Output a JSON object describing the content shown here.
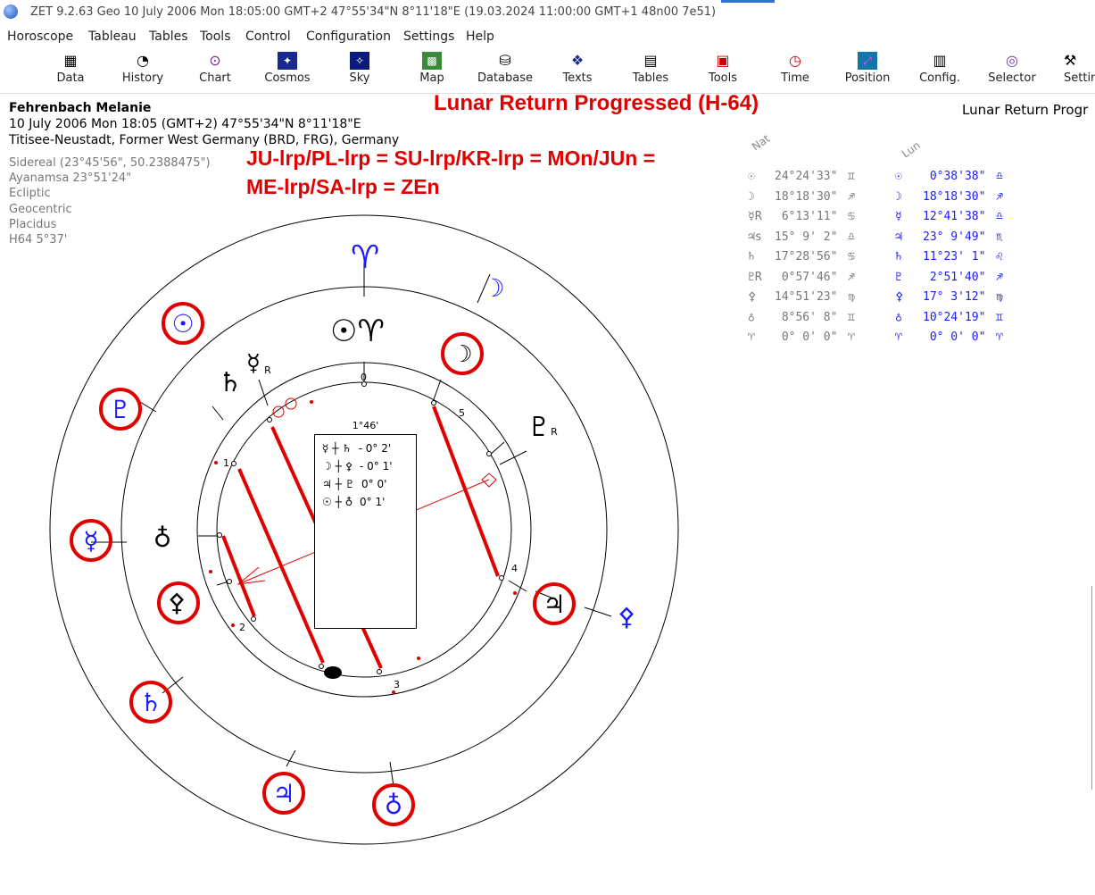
{
  "window": {
    "title": "ZET 9.2.63 Geo    10 July 2006  Mon   18:05:00 GMT+2 47°55'34\"N  8°11'18\"E  (19.03.2024  11:00:00 GMT+1 48n00 7e51)"
  },
  "menu": [
    "Horoscope",
    "Tableau",
    "Tables",
    "Tools",
    "Control",
    "Configuration",
    "Settings",
    "Help"
  ],
  "toolbar": [
    {
      "label": "Data",
      "icon": "data-icon"
    },
    {
      "label": "History",
      "icon": "history-icon"
    },
    {
      "label": "Chart",
      "icon": "chart-icon"
    },
    {
      "label": "Cosmos",
      "icon": "cosmos-icon"
    },
    {
      "label": "Sky",
      "icon": "sky-icon"
    },
    {
      "label": "Map",
      "icon": "map-icon"
    },
    {
      "label": "Database",
      "icon": "database-icon"
    },
    {
      "label": "Texts",
      "icon": "texts-icon"
    },
    {
      "label": "Tables",
      "icon": "tables-icon"
    },
    {
      "label": "Tools",
      "icon": "tools-icon"
    },
    {
      "label": "Time",
      "icon": "time-icon"
    },
    {
      "label": "Position",
      "icon": "position-icon"
    },
    {
      "label": "Config.",
      "icon": "config-icon"
    },
    {
      "label": "Selector",
      "icon": "selector-icon"
    },
    {
      "label": "Settin",
      "icon": "settings-icon"
    }
  ],
  "person": {
    "name": "Fehrenbach Melanie",
    "datetime": "10 July 2006  Mon  18:05 (GMT+2) 47°55'34\"N  8°11'18\"E",
    "place": "Titisee-Neustadt, Former West Germany (BRD, FRG), Germany"
  },
  "settings": [
    "Sidereal (23°45'56\", 50.2388475\")",
    "Ayanamsa 23°51'24\"",
    "Ecliptic",
    "Geocentric",
    "Placidus",
    "H64   5°37'"
  ],
  "chart_title": "Lunar Return Progressed (H-64)",
  "chart_title_right": "Lunar Return Progr",
  "formula": {
    "line1": "JU-lrp/PL-lrp = SU-lrp/KR-lrp = MOn/JUn =",
    "line2": "ME-lrp/SA-lrp = ZEn"
  },
  "table_headers": {
    "left": "Nat",
    "right": "Lun"
  },
  "positions": [
    {
      "gl": "☉",
      "nat": "24°24'33\"",
      "nsign": "♊",
      "lg": "☉",
      "lun": " 0°38'38\"",
      "lsign": "♎"
    },
    {
      "gl": "☽",
      "nat": "18°18'30\"",
      "nsign": "♐",
      "lg": "☽",
      "lun": "18°18'30\"",
      "lsign": "♐"
    },
    {
      "gl": "☿R",
      "nat": " 6°13'11\"",
      "nsign": "♋",
      "lg": "☿",
      "lun": "12°41'38\"",
      "lsign": "♎"
    },
    {
      "gl": "♃s",
      "nat": "15° 9' 2\"",
      "nsign": "♎",
      "lg": "♃",
      "lun": "23° 9'49\"",
      "lsign": "♏"
    },
    {
      "gl": "♄",
      "nat": "17°28'56\"",
      "nsign": "♋",
      "lg": "♄",
      "lun": "11°23' 1\"",
      "lsign": "♌"
    },
    {
      "gl": "♇R",
      "nat": " 0°57'46\"",
      "nsign": "♐",
      "lg": "♇",
      "lun": " 2°51'40\"",
      "lsign": "♐"
    },
    {
      "gl": "⚴",
      "nat": "14°51'23\"",
      "nsign": "♍",
      "lg": "⚴",
      "lun": "17° 3'12\"",
      "lsign": "♍"
    },
    {
      "gl": "♁",
      "nat": " 8°56' 8\"",
      "nsign": "♊",
      "lg": "♁",
      "lun": "10°24'19\"",
      "lsign": "♊"
    },
    {
      "gl": "♈",
      "nat": " 0° 0' 0\"",
      "nsign": "♈",
      "lg": "♈",
      "lun": " 0° 0' 0\"",
      "lsign": "♈"
    }
  ],
  "aspect_box": {
    "title": "1°46'",
    "rows": [
      {
        "a": "☿",
        "b": "♄",
        "val": "- 0° 2'"
      },
      {
        "a": "☽",
        "b": "⚴",
        "val": "- 0° 1'"
      },
      {
        "a": "♃",
        "b": "♇",
        "val": "0° 0'"
      },
      {
        "a": "☉",
        "b": "♁",
        "val": "0° 1'"
      }
    ]
  },
  "wheel": {
    "top_aries": "♈",
    "sun_aries": "☉♈",
    "house_numbers": [
      "0",
      "1",
      "2",
      "3",
      "4",
      "5"
    ],
    "outer_glyphs": [
      {
        "name": "outer-moon-glyph",
        "glyph": "☽"
      },
      {
        "name": "outer-sun-glyph",
        "glyph": "☉"
      },
      {
        "name": "outer-pluto-glyph",
        "glyph": "♇"
      },
      {
        "name": "outer-mercury-glyph",
        "glyph": "☿"
      },
      {
        "name": "outer-saturn-glyph",
        "glyph": "♄"
      },
      {
        "name": "outer-jupiter-glyph",
        "glyph": "♃"
      },
      {
        "name": "outer-earth-glyph",
        "glyph": "♁"
      },
      {
        "name": "outer-kronos-glyph",
        "glyph": "⚴"
      }
    ],
    "inner_glyphs": [
      {
        "name": "inner-saturn-glyph",
        "glyph": "♄"
      },
      {
        "name": "inner-mercury-glyph",
        "glyph": "☿"
      },
      {
        "name": "inner-mercury-retro",
        "glyph": "R"
      },
      {
        "name": "inner-moon-glyph",
        "glyph": "☽"
      },
      {
        "name": "inner-pluto-glyph",
        "glyph": "♇"
      },
      {
        "name": "inner-pluto-retro",
        "glyph": "R"
      },
      {
        "name": "inner-earth-glyph",
        "glyph": "♁"
      },
      {
        "name": "inner-kronos-glyph",
        "glyph": "⚴"
      },
      {
        "name": "inner-jupiter-glyph",
        "glyph": "♃"
      }
    ]
  },
  "colors": {
    "highlight": "#e00000",
    "planet_blue": "#1a1aff",
    "text_gray": "#777777"
  }
}
